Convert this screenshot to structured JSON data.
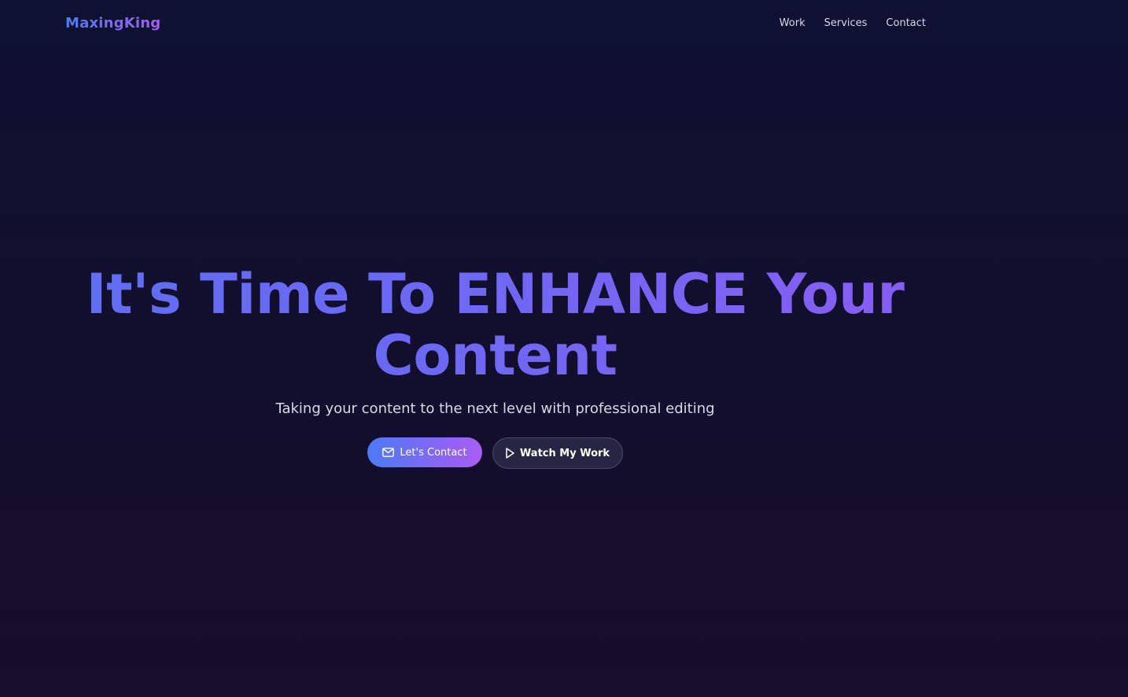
{
  "header": {
    "logo": "MaxingKing",
    "nav": [
      {
        "label": "Work"
      },
      {
        "label": "Services"
      },
      {
        "label": "Contact"
      }
    ]
  },
  "hero": {
    "title_line1": "It's Time To ENHANCE Your",
    "title_line2": "Content",
    "subtitle": "Taking your content to the next level with professional editing",
    "primary_button": {
      "label": "Let's Contact",
      "icon": "mail-icon"
    },
    "secondary_button": {
      "label": "Watch My Work",
      "icon": "play-icon"
    }
  },
  "colors": {
    "background_top": "#0e1130",
    "background_bottom": "#180d2b",
    "accent_blue": "#4b7bf3",
    "accent_purple": "#a85ef2"
  }
}
